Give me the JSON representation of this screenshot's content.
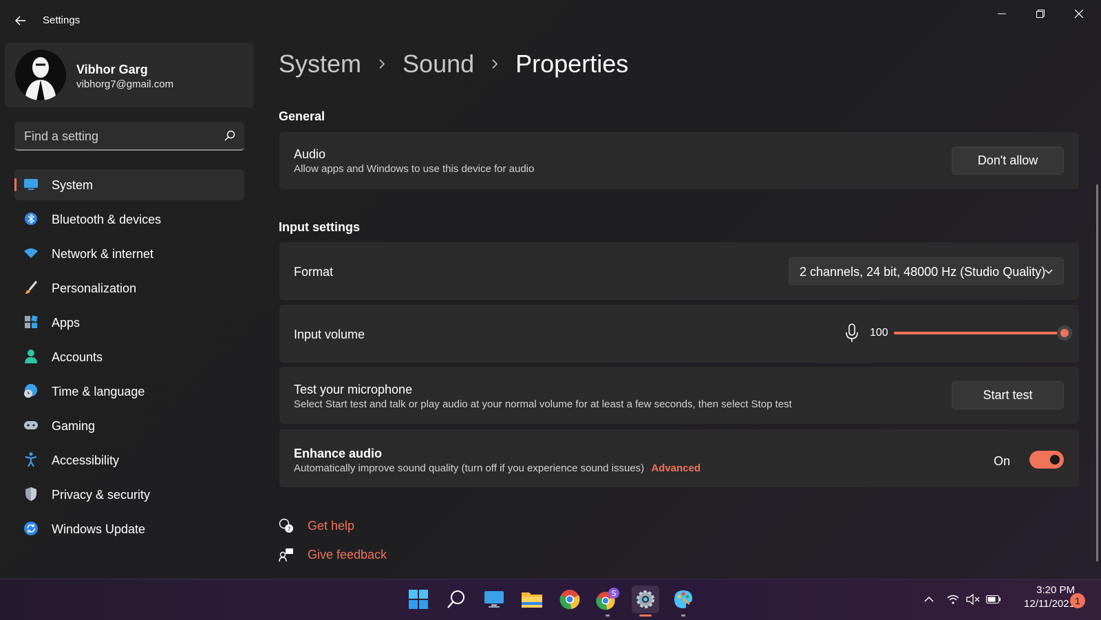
{
  "app": {
    "title": "Settings"
  },
  "profile": {
    "name": "Vibhor Garg",
    "email": "vibhorg7@gmail.com"
  },
  "search": {
    "placeholder": "Find a setting"
  },
  "nav": {
    "items": [
      {
        "label": "System",
        "icon": "system-display-icon",
        "active": true
      },
      {
        "label": "Bluetooth & devices",
        "icon": "bluetooth-icon"
      },
      {
        "label": "Network & internet",
        "icon": "wifi-icon"
      },
      {
        "label": "Personalization",
        "icon": "brush-icon"
      },
      {
        "label": "Apps",
        "icon": "apps-icon"
      },
      {
        "label": "Accounts",
        "icon": "accounts-icon"
      },
      {
        "label": "Time & language",
        "icon": "globe-clock-icon"
      },
      {
        "label": "Gaming",
        "icon": "gamepad-icon"
      },
      {
        "label": "Accessibility",
        "icon": "accessibility-icon"
      },
      {
        "label": "Privacy & security",
        "icon": "shield-icon"
      },
      {
        "label": "Windows Update",
        "icon": "update-icon"
      }
    ]
  },
  "breadcrumb": {
    "items": [
      "System",
      "Sound",
      "Properties"
    ]
  },
  "general": {
    "heading": "General",
    "audio": {
      "title": "Audio",
      "subtitle": "Allow apps and Windows to use this device for audio",
      "button": "Don't allow"
    }
  },
  "input_settings": {
    "heading": "Input settings",
    "format": {
      "title": "Format",
      "value": "2 channels, 24 bit, 48000 Hz (Studio Quality)"
    },
    "input_volume": {
      "title": "Input volume",
      "value": "100",
      "level": 1.0
    },
    "test_mic": {
      "title": "Test your microphone",
      "subtitle": "Select Start test and talk or play audio at your normal volume for at least a few seconds, then select Stop test",
      "button": "Start test"
    },
    "enhance": {
      "title": "Enhance audio",
      "subtitle": "Automatically improve sound quality (turn off if you experience sound issues)",
      "link": "Advanced",
      "state_label": "On",
      "on": true
    }
  },
  "help": {
    "get_help": "Get help",
    "give_feedback": "Give feedback"
  },
  "taskbar": {
    "apps": [
      "start-icon",
      "search-icon",
      "desktop-icon",
      "file-explorer-icon",
      "chrome-icon",
      "chrome-profile-icon",
      "settings-icon",
      "paint-icon"
    ],
    "time": "3:20 PM",
    "date": "12/11/2021",
    "notifications": "1"
  },
  "colors": {
    "accent": "#f0735a",
    "card": "#2b2b2b",
    "background": "#202020"
  }
}
